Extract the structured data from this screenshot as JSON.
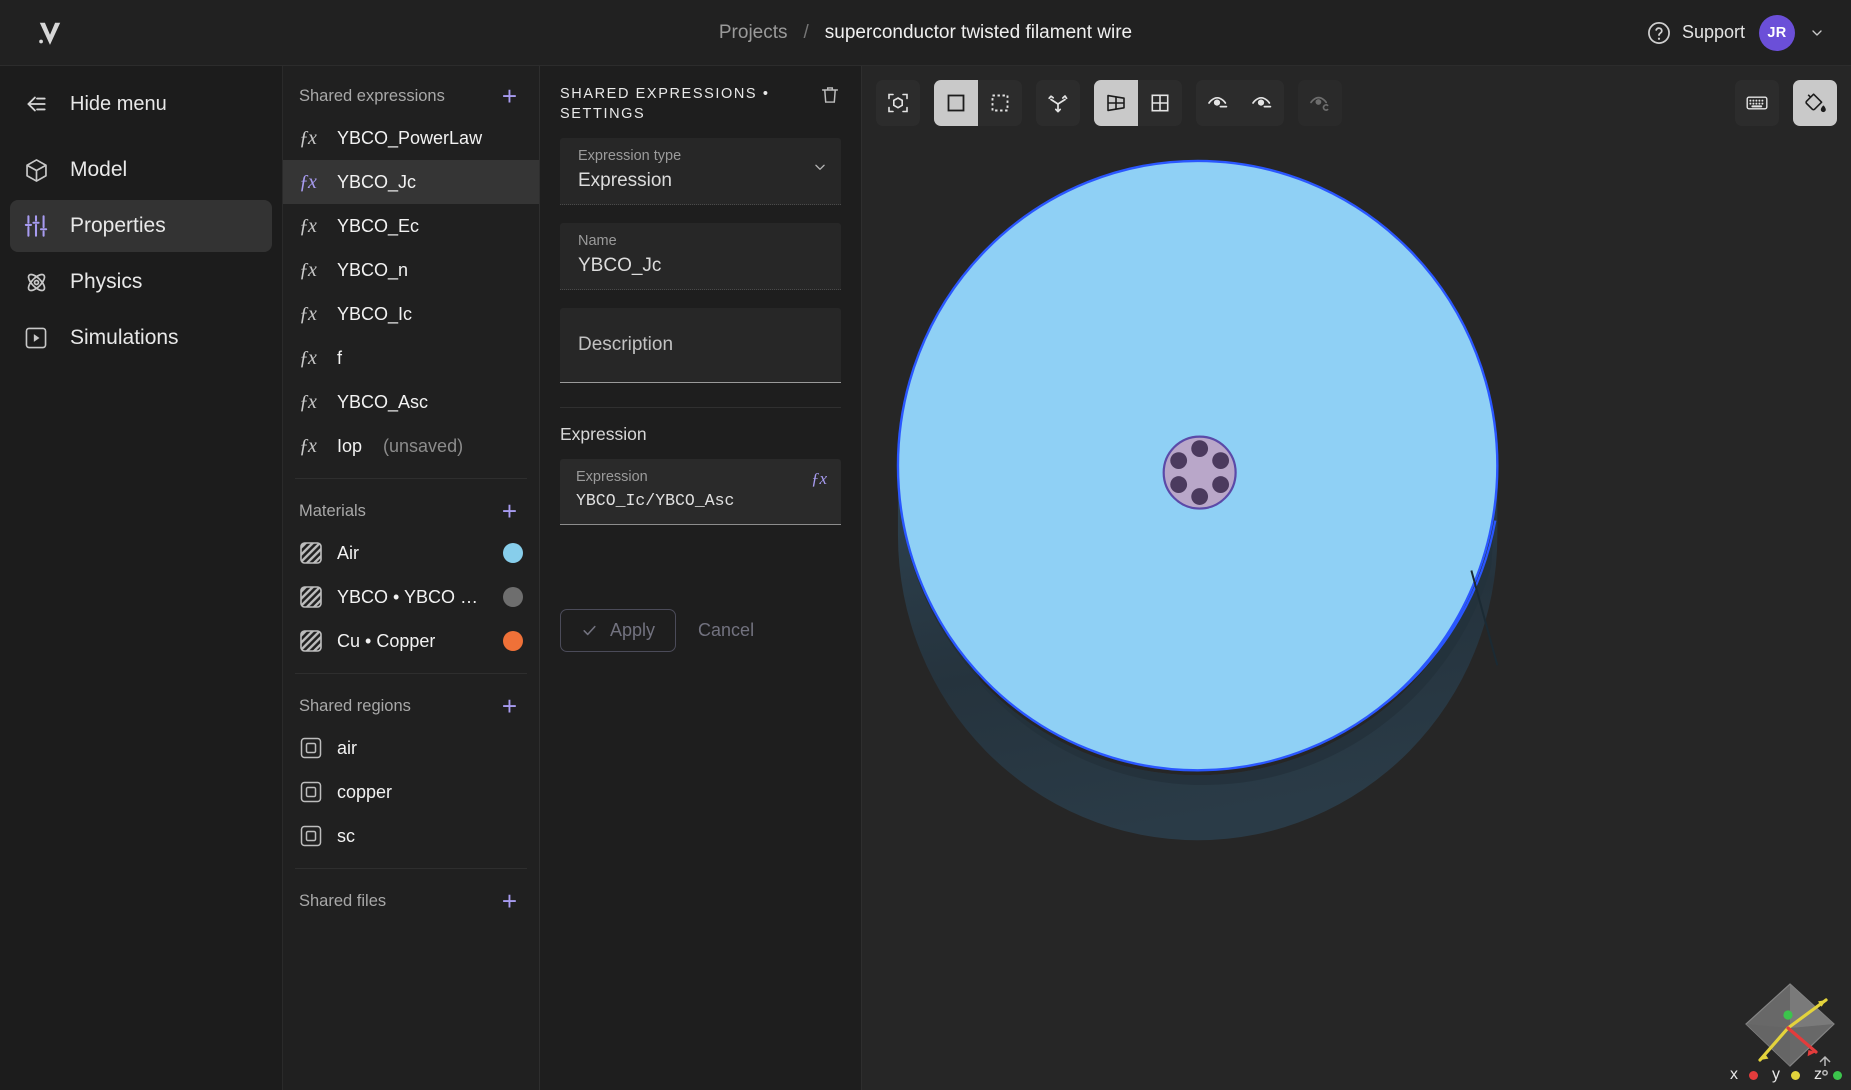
{
  "header": {
    "logo_icon": "appostrophe-logo-icon",
    "breadcrumb_root": "Projects",
    "breadcrumb_sep": "/",
    "breadcrumb_title": "superconductor twisted filament wire",
    "support_label": "Support",
    "help_icon": "question-circle-icon",
    "avatar_initials": "JR",
    "avatar_color": "#6b4fd8",
    "chevron_icon": "chevron-down-icon"
  },
  "sidebar": {
    "hide_menu_label": "Hide menu",
    "hide_menu_icon": "arrow-left-collapse-icon",
    "items": [
      {
        "label": "Model",
        "icon": "cube-icon",
        "active": false
      },
      {
        "label": "Properties",
        "icon": "sliders-icon",
        "active": true
      },
      {
        "label": "Physics",
        "icon": "atom-icon",
        "active": false
      },
      {
        "label": "Simulations",
        "icon": "play-square-icon",
        "active": false
      }
    ]
  },
  "tree": {
    "sections": [
      {
        "title": "Shared expressions",
        "add_icon": "plus-icon",
        "items": [
          {
            "label": "YBCO_PowerLaw",
            "icon": "fx-icon",
            "selected": false
          },
          {
            "label": "YBCO_Jc",
            "icon": "fx-icon",
            "selected": true
          },
          {
            "label": "YBCO_Ec",
            "icon": "fx-icon",
            "selected": false
          },
          {
            "label": "YBCO_n",
            "icon": "fx-icon",
            "selected": false
          },
          {
            "label": "YBCO_Ic",
            "icon": "fx-icon",
            "selected": false
          },
          {
            "label": "f",
            "icon": "fx-icon",
            "selected": false
          },
          {
            "label": "YBCO_Asc",
            "icon": "fx-icon",
            "selected": false
          },
          {
            "label": "Iop",
            "suffix": "(unsaved)",
            "icon": "fx-icon",
            "selected": false
          }
        ]
      },
      {
        "title": "Materials",
        "add_icon": "plus-icon",
        "items": [
          {
            "label": "Air",
            "icon": "hatch-square-icon",
            "swatch": "#87ceeb"
          },
          {
            "label": "YBCO • YBCO …",
            "icon": "hatch-square-icon",
            "swatch": "#6e6e6e"
          },
          {
            "label": "Cu • Copper",
            "icon": "hatch-square-icon",
            "swatch": "#ef7138"
          }
        ]
      },
      {
        "title": "Shared regions",
        "add_icon": "plus-icon",
        "items": [
          {
            "label": "air",
            "icon": "region-icon"
          },
          {
            "label": "copper",
            "icon": "region-icon"
          },
          {
            "label": "sc",
            "icon": "region-icon"
          }
        ]
      },
      {
        "title": "Shared files",
        "add_icon": "plus-icon",
        "items": []
      }
    ]
  },
  "settings": {
    "title": "SHARED EXPRESSIONS • SETTINGS",
    "delete_icon": "trash-icon",
    "expression_type": {
      "label": "Expression type",
      "value": "Expression",
      "caret_icon": "chevron-down-icon"
    },
    "name": {
      "label": "Name",
      "value": "YBCO_Jc"
    },
    "description": {
      "placeholder": "Description",
      "value": ""
    },
    "expression_group_label": "Expression",
    "expression": {
      "label": "Expression",
      "value": "YBCO_Ic/YBCO_Asc",
      "fx_icon": "fx-icon"
    },
    "apply_label": "Apply",
    "apply_icon": "check-icon",
    "cancel_label": "Cancel"
  },
  "viewport": {
    "toolbar": [
      {
        "name": "fit-to-view-button",
        "icon": "cube-frame-icon",
        "state": "normal"
      },
      {
        "name": "select-face-button",
        "icon": "filled-square-icon",
        "state": "active"
      },
      {
        "name": "select-box-button",
        "icon": "dashed-square-icon",
        "state": "normal"
      },
      {
        "name": "axes-button",
        "icon": "axes-icon",
        "state": "normal"
      },
      {
        "name": "perspective-view-button",
        "icon": "perspective-grid-icon",
        "state": "active"
      },
      {
        "name": "orthographic-view-button",
        "icon": "grid-square-icon",
        "state": "normal"
      },
      {
        "name": "show-all-button",
        "icon": "eye-minus-icon",
        "state": "normal"
      },
      {
        "name": "hide-all-button",
        "icon": "eye-minus-alt-icon",
        "state": "normal"
      },
      {
        "name": "clip-view-button",
        "icon": "eye-c-icon",
        "state": "disabled"
      },
      {
        "name": "keyboard-shortcuts-button",
        "icon": "keyboard-icon",
        "state": "normal"
      },
      {
        "name": "fill-color-button",
        "icon": "paint-bucket-icon",
        "state": "active"
      }
    ],
    "axis_labels": [
      {
        "label": "x",
        "color": "#e33c3c"
      },
      {
        "label": "y",
        "color": "#e3d33c"
      },
      {
        "label": "z",
        "color": "#3cc44c"
      }
    ],
    "geometry": {
      "outer_cylinder_color": "#8fd0f5",
      "outer_cylinder_edge": "#2a57ff",
      "core_color": "#b9a7c9",
      "core_edge": "#5b4aa8",
      "filament_color": "#4b3a5e",
      "filament_count": 6
    },
    "measure_icon": "measure-icon"
  }
}
